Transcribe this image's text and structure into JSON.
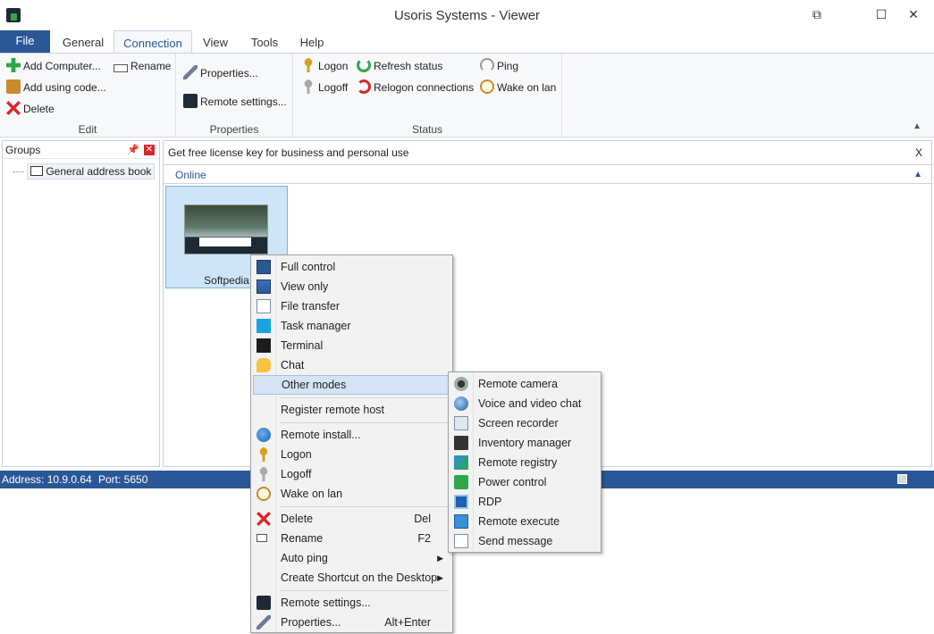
{
  "window": {
    "title": "Usoris Systems - Viewer",
    "controls": {
      "restore": "⧉",
      "maximize": "☐",
      "close": "✕"
    }
  },
  "tabs": {
    "file": "File",
    "items": [
      "General",
      "Connection",
      "View",
      "Tools",
      "Help"
    ],
    "active": "Connection"
  },
  "ribbon": {
    "edit": {
      "label": "Edit",
      "add_computer": "Add Computer...",
      "rename": "Rename",
      "add_using_code": "Add using code...",
      "delete": "Delete"
    },
    "properties": {
      "label": "Properties",
      "properties": "Properties...",
      "remote_settings": "Remote settings..."
    },
    "status": {
      "label": "Status",
      "logon": "Logon",
      "logoff": "Logoff",
      "refresh_status": "Refresh status",
      "relogon_connections": "Relogon connections",
      "ping": "Ping",
      "wake_on_lan": "Wake on lan"
    },
    "collapse_icon": "chevron-up-icon"
  },
  "groups": {
    "header": "Groups",
    "tree_item": "General address book"
  },
  "main": {
    "banner": "Get free license key for business and personal use",
    "banner_close": "X",
    "section": "Online",
    "tile_name": "Softpedia"
  },
  "statusbar": {
    "address": "Address: 10.9.0.64",
    "port": "Port: 5650"
  },
  "context_menu": {
    "full_control": "Full control",
    "view_only": "View only",
    "file_transfer": "File transfer",
    "task_manager": "Task manager",
    "terminal": "Terminal",
    "chat": "Chat",
    "other_modes": "Other modes",
    "register_remote_host": "Register remote host",
    "remote_install": "Remote install...",
    "logon": "Logon",
    "logoff": "Logoff",
    "wake_on_lan": "Wake on lan",
    "delete": "Delete",
    "delete_shortcut": "Del",
    "rename": "Rename",
    "rename_shortcut": "F2",
    "auto_ping": "Auto ping",
    "create_shortcut": "Create Shortcut on the Desktop",
    "remote_settings": "Remote settings...",
    "properties": "Properties...",
    "properties_shortcut": "Alt+Enter"
  },
  "submenu": {
    "remote_camera": "Remote camera",
    "voice_video_chat": "Voice and video chat",
    "screen_recorder": "Screen recorder",
    "inventory_manager": "Inventory manager",
    "remote_registry": "Remote registry",
    "power_control": "Power control",
    "rdp": "RDP",
    "remote_execute": "Remote execute",
    "send_message": "Send message"
  }
}
